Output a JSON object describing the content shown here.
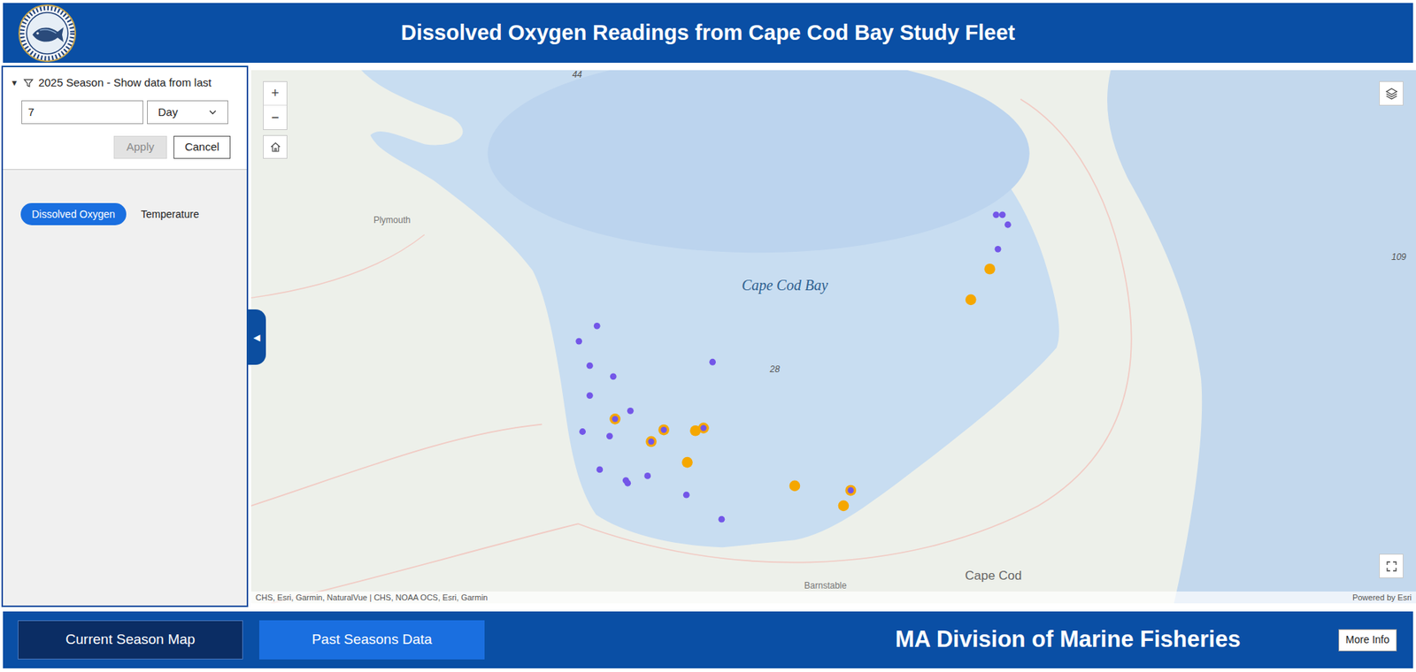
{
  "header": {
    "title": "Dissolved Oxygen Readings from Cape Cod Bay Study Fleet"
  },
  "filter": {
    "expand_icon": "▼",
    "expanded": true,
    "label": "2025 Season - Show data from last",
    "value": "7",
    "unit": "Day",
    "apply": {
      "label": "Apply",
      "disabled": true
    },
    "cancel": {
      "label": "Cancel"
    }
  },
  "layer_toggle": [
    {
      "label": "Dissolved Oxygen",
      "selected": true
    },
    {
      "label": "Temperature",
      "selected": false
    }
  ],
  "panel_toggle": {
    "icon": "◀"
  },
  "map": {
    "zoom_in": "+",
    "zoom_out": "−",
    "labels": [
      {
        "text": "44",
        "kind": "depth"
      },
      {
        "text": "Plymouth",
        "kind": "town"
      },
      {
        "text": "Cape Cod Bay",
        "kind": "water"
      },
      {
        "text": "28",
        "kind": "depth"
      },
      {
        "text": "109",
        "kind": "depth"
      },
      {
        "text": "Cape Cod",
        "kind": "region"
      },
      {
        "text": "Barnstable",
        "kind": "town"
      }
    ],
    "attribution": "CHS, Esri, Garmin, NaturalVue | CHS, NOAA OCS, Esri, Garmin",
    "powered_by": "Powered by Esri",
    "markers": [
      {
        "kind": "small",
        "color": "#7356e8"
      },
      {
        "kind": "small",
        "color": "#7356e8"
      },
      {
        "kind": "small",
        "color": "#7356e8"
      },
      {
        "kind": "small",
        "color": "#7356e8"
      },
      {
        "kind": "small",
        "color": "#7356e8"
      },
      {
        "kind": "small",
        "color": "#7356e8"
      },
      {
        "kind": "small",
        "color": "#7356e8"
      },
      {
        "kind": "small",
        "color": "#7356e8"
      },
      {
        "kind": "small",
        "color": "#7356e8"
      },
      {
        "kind": "small",
        "color": "#7356e8"
      },
      {
        "kind": "small",
        "color": "#7356e8"
      },
      {
        "kind": "small",
        "color": "#7356e8"
      },
      {
        "kind": "small",
        "color": "#7356e8"
      },
      {
        "kind": "small",
        "color": "#7356e8"
      },
      {
        "kind": "small",
        "color": "#7356e8"
      },
      {
        "kind": "small",
        "color": "#7356e8"
      },
      {
        "kind": "small",
        "color": "#7356e8"
      },
      {
        "kind": "small",
        "color": "#7356e8"
      },
      {
        "kind": "small",
        "color": "#7356e8"
      },
      {
        "kind": "large",
        "color": "#f5a700"
      },
      {
        "kind": "large",
        "color": "#f5a700"
      },
      {
        "kind": "large",
        "color": "#f5a700"
      },
      {
        "kind": "large",
        "color": "#f5a700"
      },
      {
        "kind": "large",
        "color": "#f5a700"
      },
      {
        "kind": "large",
        "color": "#f5a700"
      },
      {
        "kind": "stacked",
        "color": "#f5a700",
        "inner_color": "#7356e8"
      },
      {
        "kind": "stacked",
        "color": "#f5a700",
        "inner_color": "#7356e8"
      },
      {
        "kind": "stacked",
        "color": "#f5a700",
        "inner_color": "#7356e8"
      },
      {
        "kind": "stacked",
        "color": "#f5a700",
        "inner_color": "#7356e8"
      },
      {
        "kind": "stacked",
        "color": "#f5a700",
        "inner_color": "#7356e8"
      }
    ]
  },
  "footer": {
    "tabs": [
      {
        "label": "Current Season Map",
        "selected": true
      },
      {
        "label": "Past Seasons Data",
        "selected": false
      }
    ],
    "org": "MA Division of Marine Fisheries",
    "more_info": "More Info"
  }
}
